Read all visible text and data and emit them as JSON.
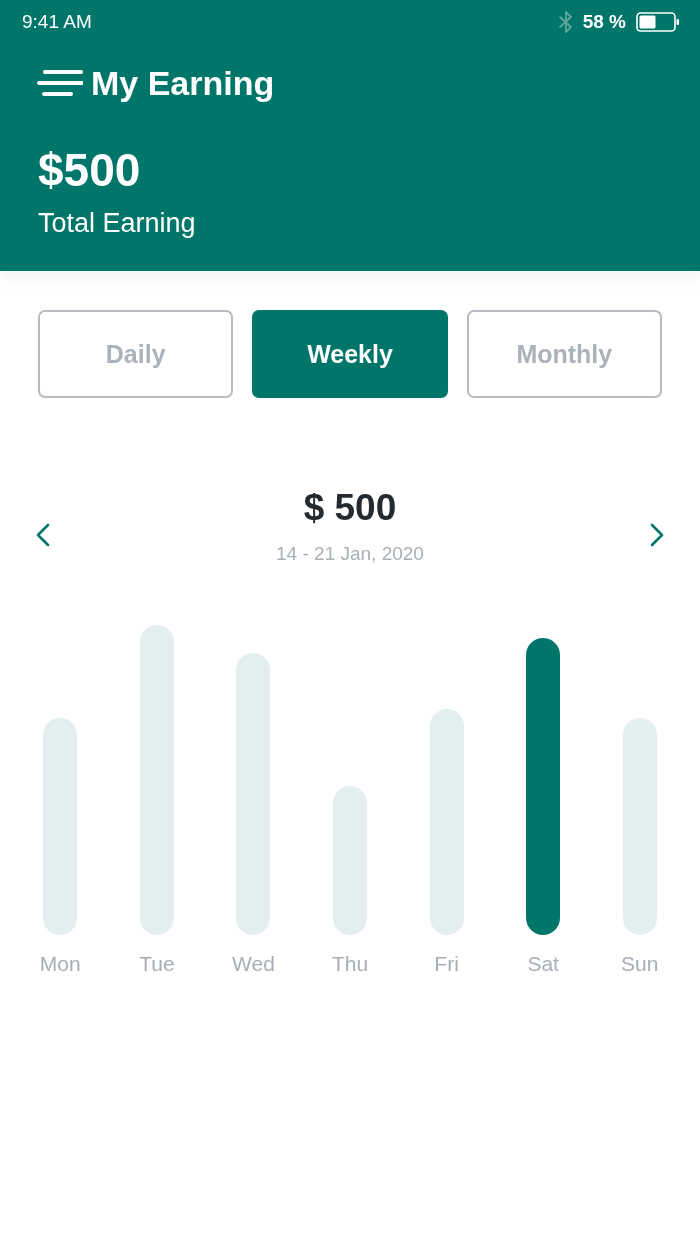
{
  "status_bar": {
    "time": "9:41 AM",
    "battery": "58 %"
  },
  "header": {
    "title": "My Earning",
    "total": "$500",
    "total_label": "Total Earning"
  },
  "tabs": [
    {
      "label": "Daily",
      "selected": false
    },
    {
      "label": "Weekly",
      "selected": true
    },
    {
      "label": "Monthly",
      "selected": false
    }
  ],
  "period": {
    "amount": "$ 500",
    "range": "14 - 21 Jan, 2020"
  },
  "days": [
    {
      "label": "Mon",
      "selected": false
    },
    {
      "label": "Tue",
      "selected": false
    },
    {
      "label": "Wed",
      "selected": false
    },
    {
      "label": "Thu",
      "selected": false
    },
    {
      "label": "Fri",
      "selected": false
    },
    {
      "label": "Sat",
      "selected": true
    },
    {
      "label": "Sun",
      "selected": false
    }
  ]
}
